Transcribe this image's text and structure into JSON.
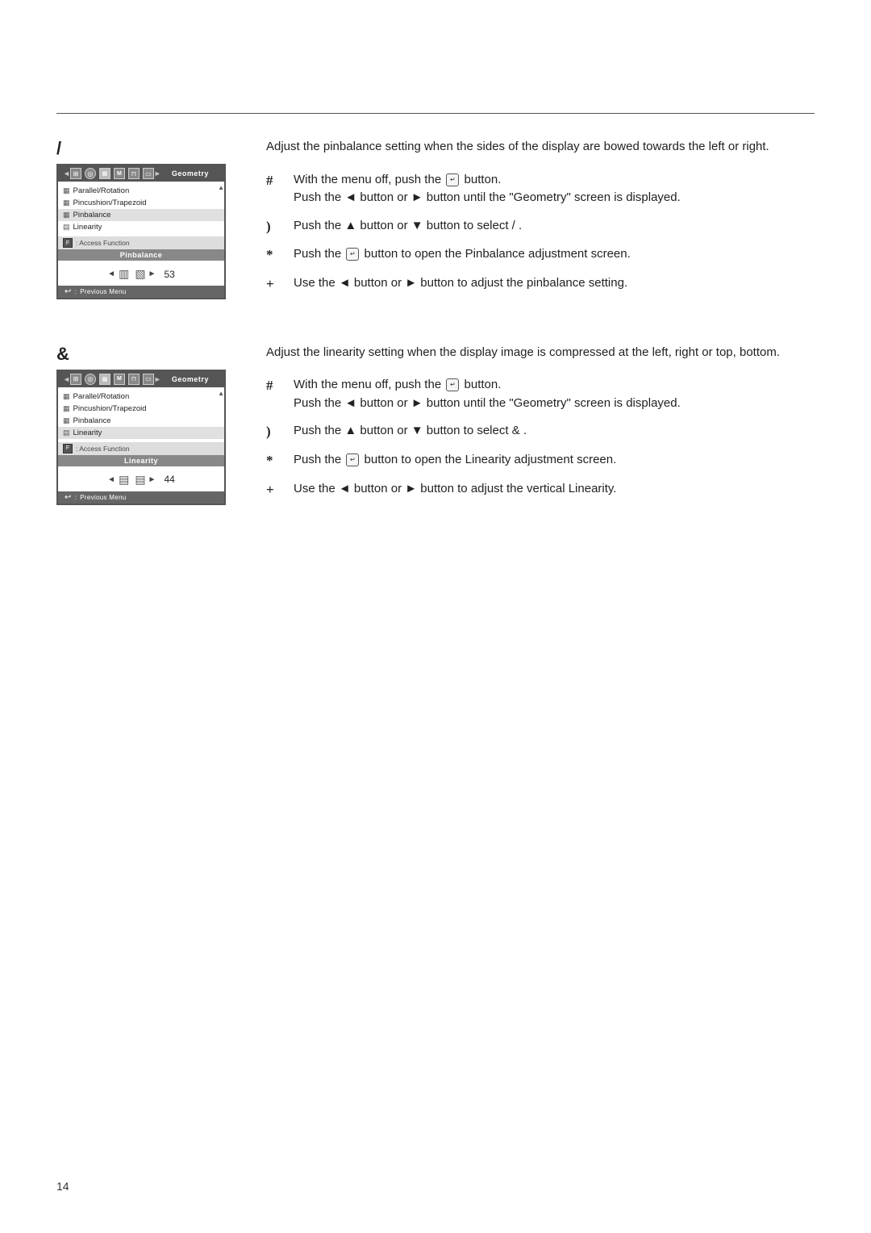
{
  "page": {
    "number": "14",
    "rule_present": true
  },
  "section1": {
    "symbol": "/",
    "intro": "Adjust the pinbalance setting when the sides of the display are bowed towards the left or right.",
    "monitor": {
      "title": "Geometry",
      "menu_items": [
        {
          "icon": "▦",
          "label": "Parallel/Rotation"
        },
        {
          "icon": "▦",
          "label": "Pincushion/Trapezoid"
        },
        {
          "icon": "▦",
          "label": "Pinbalance"
        },
        {
          "icon": "▤",
          "label": "Linearity"
        }
      ],
      "access_label": ": Access Function",
      "submenu_title": "Pinbalance",
      "value_left_icon": "◄",
      "value_left_shape": "▥",
      "value_right_shape": "▧",
      "value_right_icon": "►",
      "value_number": "53",
      "prev_menu_label": "Previous Menu"
    },
    "steps": [
      {
        "marker": "#",
        "text": "With the menu off, push the",
        "btn": "↵",
        "text2": "button.",
        "text3": "Push the ◄ button or ► button until the \"Geometry\" screen is displayed."
      },
      {
        "marker": ")",
        "text": "Push the ▲ button or ▼ button to select /",
        "text2": "."
      },
      {
        "marker": "*",
        "text": "Push the",
        "btn": "↵",
        "text2": "button to open the Pinbalance adjustment screen."
      },
      {
        "marker": "+",
        "text": "Use the ◄ button or ► button to adjust the pinbalance setting."
      }
    ]
  },
  "section2": {
    "symbol": "&",
    "intro": "Adjust the linearity setting when the display image is compressed at the left, right or top, bottom.",
    "monitor": {
      "title": "Geometry",
      "menu_items": [
        {
          "icon": "▦",
          "label": "Parallel/Rotation"
        },
        {
          "icon": "▦",
          "label": "Pincushion/Trapezoid"
        },
        {
          "icon": "▦",
          "label": "Pinbalance"
        },
        {
          "icon": "▤",
          "label": "Linearity"
        }
      ],
      "access_label": ": Access Function",
      "submenu_title": "Linearity",
      "value_left_icon": "◄",
      "value_left_shape": "▤",
      "value_right_shape": "▤",
      "value_right_icon": "►",
      "value_number": "44",
      "prev_menu_label": "Previous Menu"
    },
    "steps": [
      {
        "marker": "#",
        "text": "With the menu off, push the",
        "btn": "↵",
        "text2": "button.",
        "text3": "Push the ◄ button or ► button until the \"Geometry\" screen is displayed."
      },
      {
        "marker": ")",
        "text": "Push the ▲ button or ▼ button to select &",
        "text2": "."
      },
      {
        "marker": "*",
        "text": "Push the",
        "btn": "↵",
        "text2": "button to open the Linearity adjustment screen."
      },
      {
        "marker": "+",
        "text": "Use the ◄ button or ► button to adjust the vertical Linearity."
      }
    ]
  },
  "icons": {
    "arrow_left": "◄",
    "arrow_right": "►",
    "arrow_up": "▲",
    "arrow_down": "▼",
    "enter_btn": "↵"
  }
}
